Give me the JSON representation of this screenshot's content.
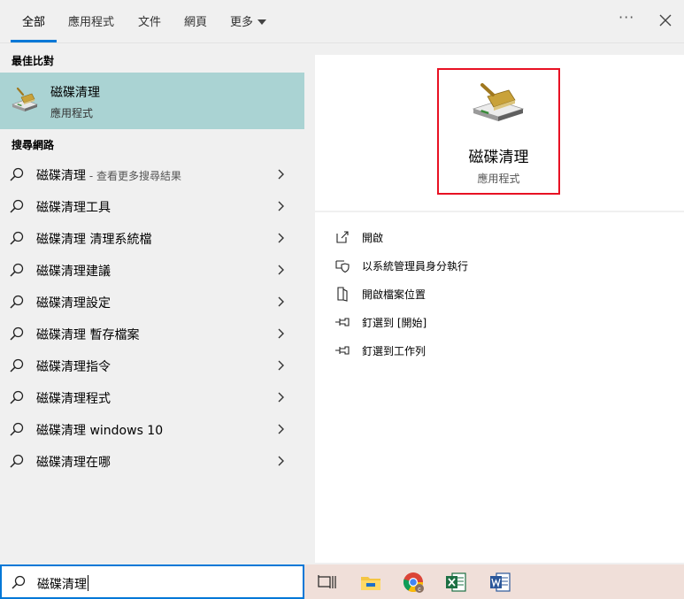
{
  "tabs": [
    "全部",
    "應用程式",
    "文件",
    "網頁",
    "更多"
  ],
  "sections": {
    "best_match": "最佳比對",
    "search_web": "搜尋網路"
  },
  "best_match": {
    "name": "磁碟清理",
    "type": "應用程式"
  },
  "web_results": [
    {
      "text": "磁碟清理",
      "suffix": " - 查看更多搜尋結果"
    },
    {
      "text": "磁碟清理工具",
      "suffix": ""
    },
    {
      "text": "磁碟清理 清理系統檔",
      "suffix": ""
    },
    {
      "text": "磁碟清理建議",
      "suffix": ""
    },
    {
      "text": "磁碟清理設定",
      "suffix": ""
    },
    {
      "text": "磁碟清理 暫存檔案",
      "suffix": ""
    },
    {
      "text": "磁碟清理指令",
      "suffix": ""
    },
    {
      "text": "磁碟清理程式",
      "suffix": ""
    },
    {
      "text": "磁碟清理 windows 10",
      "suffix": ""
    },
    {
      "text": "磁碟清理在哪",
      "suffix": ""
    }
  ],
  "detail": {
    "name": "磁碟清理",
    "type": "應用程式"
  },
  "actions": [
    {
      "label": "開啟",
      "icon": "open-icon"
    },
    {
      "label": "以系統管理員身分執行",
      "icon": "shield-admin-icon"
    },
    {
      "label": "開啟檔案位置",
      "icon": "file-location-icon"
    },
    {
      "label": "釘選到 [開始]",
      "icon": "pin-icon"
    },
    {
      "label": "釘選到工作列",
      "icon": "pin-icon"
    }
  ],
  "search": {
    "value": "磁碟清理"
  },
  "taskbar": [
    "task-view-icon",
    "file-explorer-icon",
    "chrome-icon",
    "excel-icon",
    "word-icon"
  ],
  "colors": {
    "accent": "#0078d7",
    "selected_bg": "#aad3d3",
    "highlight_border": "#e81123",
    "taskbar_bg": "#f0dfd9"
  }
}
